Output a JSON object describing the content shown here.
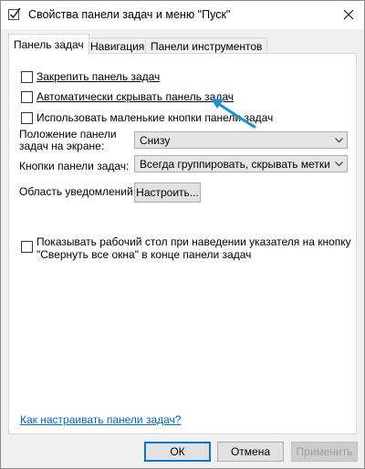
{
  "window": {
    "title": "Свойства панели задач и меню \"Пуск\"",
    "icons": {
      "app": "taskbar-checkbox-icon",
      "close": "close-icon"
    }
  },
  "tabs": [
    {
      "label": "Панель задач",
      "active": true
    },
    {
      "label": "Навигация",
      "active": false
    },
    {
      "label": "Панели инструментов",
      "active": false
    }
  ],
  "taskbar": {
    "lock_label": "Закрепить панель задач",
    "lock_checked": false,
    "autohide_label": "Автоматически скрывать панель задач",
    "autohide_checked": false,
    "small_buttons_label": "Использовать маленькие кнопки панели задач",
    "small_buttons_checked": false,
    "position_label_line1": "Положение панели",
    "position_label_line2": "задач на экране:",
    "position_value": "Снизу",
    "buttons_label": "Кнопки панели задач:",
    "buttons_value": "Всегда группировать, скрывать метки",
    "notification_label": "Область уведомлений:",
    "customize_button": "Настроить...",
    "peek_label_line1": "Показывать рабочий стол при наведении указателя на кнопку",
    "peek_label_line2": "\"Свернуть все окна\" в конце панели задач",
    "peek_checked": false,
    "help_link": "Как настраивать панели задач?"
  },
  "footer": {
    "ok_label": "ОК",
    "cancel_label": "Отмена",
    "apply_label": "Применить"
  },
  "colors": {
    "link": "#0066cc",
    "annotation_arrow": "#1a8fd6",
    "default_button_border": "#0078d7"
  }
}
